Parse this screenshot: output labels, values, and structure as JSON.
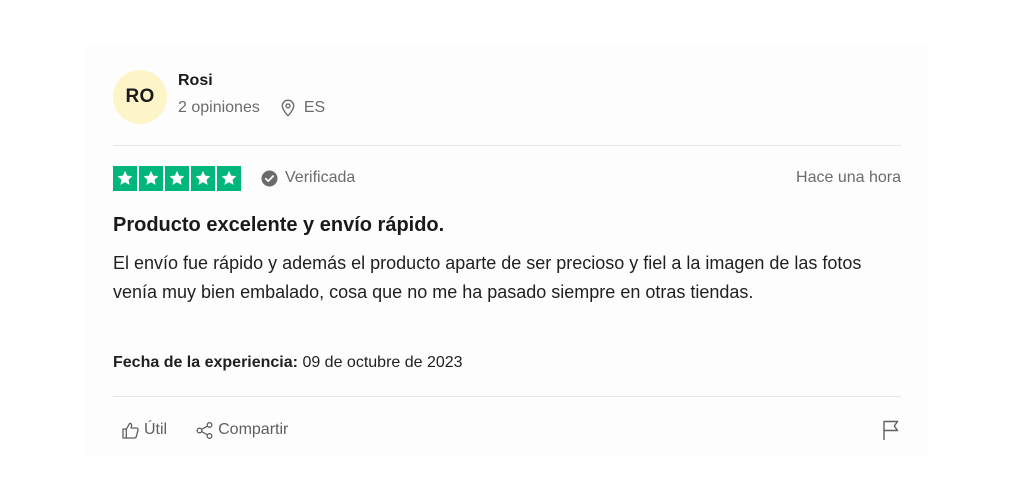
{
  "consumer": {
    "initials": "RO",
    "name": "Rosi",
    "reviews_count": "2 opiniones",
    "country": "ES"
  },
  "review": {
    "rating": 5,
    "verified_label": "Verificada",
    "time_ago": "Hace una hora",
    "title": "Producto excelente y envío rápido.",
    "body": "El envío fue rápido y además el producto aparte de ser precioso y fiel a la imagen de las fotos venía muy bien embalado, cosa que no me ha pasado siempre en otras tiendas.",
    "experience_label": "Fecha de la experiencia:",
    "experience_date": "09 de octubre de 2023"
  },
  "actions": {
    "useful_label": "Útil",
    "share_label": "Compartir"
  },
  "icons": {
    "location": "location-pin-icon",
    "verified": "check-circle-icon",
    "useful": "thumbs-up-icon",
    "share": "share-icon",
    "report": "flag-icon"
  },
  "colors": {
    "star_green": "#00b67a",
    "avatar_bg": "#fdf4c8",
    "muted_text": "#6b6b6b"
  }
}
